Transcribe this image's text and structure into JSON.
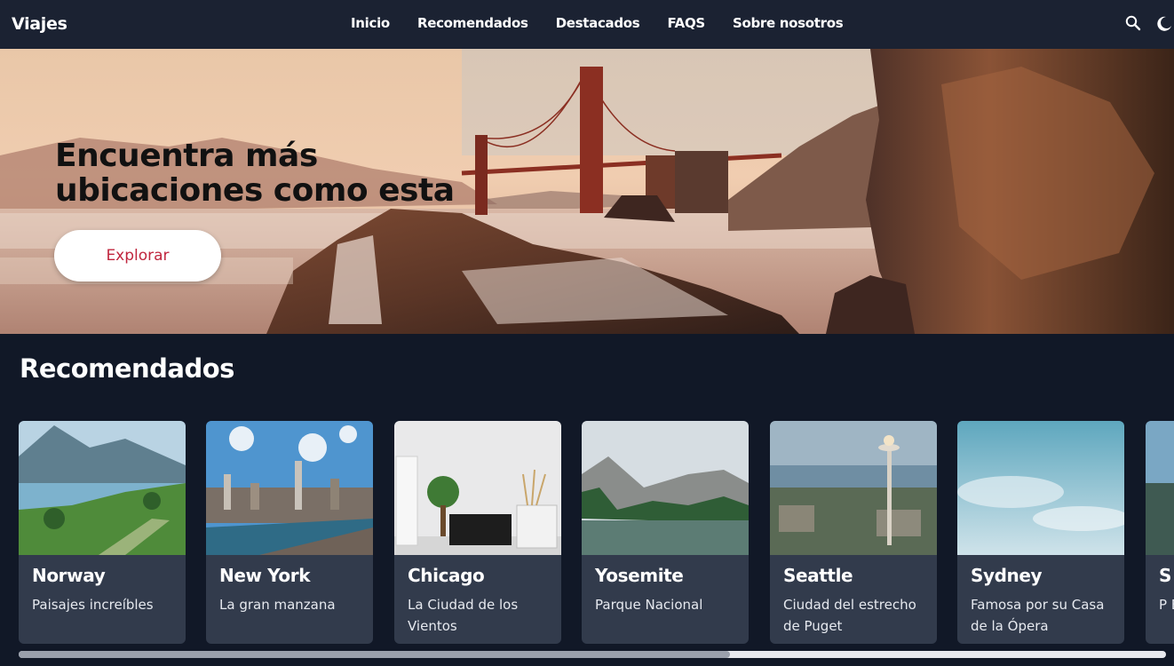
{
  "brand": "Viajes",
  "nav": {
    "links": [
      "Inicio",
      "Recomendados",
      "Destacados",
      "FAQS",
      "Sobre nosotros"
    ],
    "icons": [
      "search-icon",
      "moon-icon"
    ]
  },
  "hero": {
    "title_line1": "Encuentra más",
    "title_line2": "ubicaciones como esta",
    "button_label": "Explorar",
    "accent": "#c0263e"
  },
  "recommended": {
    "title": "Recomendados",
    "cards": [
      {
        "name": "Norway",
        "desc": "Paisajes increíbles"
      },
      {
        "name": "New York",
        "desc": "La gran manzana"
      },
      {
        "name": "Chicago",
        "desc": "La Ciudad de los Vientos"
      },
      {
        "name": "Yosemite",
        "desc": "Parque Nacional"
      },
      {
        "name": "Seattle",
        "desc": "Ciudad del estrecho de Puget"
      },
      {
        "name": "Sydney",
        "desc": "Famosa por su Casa de la Ópera"
      },
      {
        "name": "S",
        "desc": "P E"
      }
    ]
  },
  "scrollbar": {
    "position_fraction": 0.62
  },
  "colors": {
    "background": "#111827",
    "navbar": "#1b2232",
    "card": "#323b4c"
  }
}
